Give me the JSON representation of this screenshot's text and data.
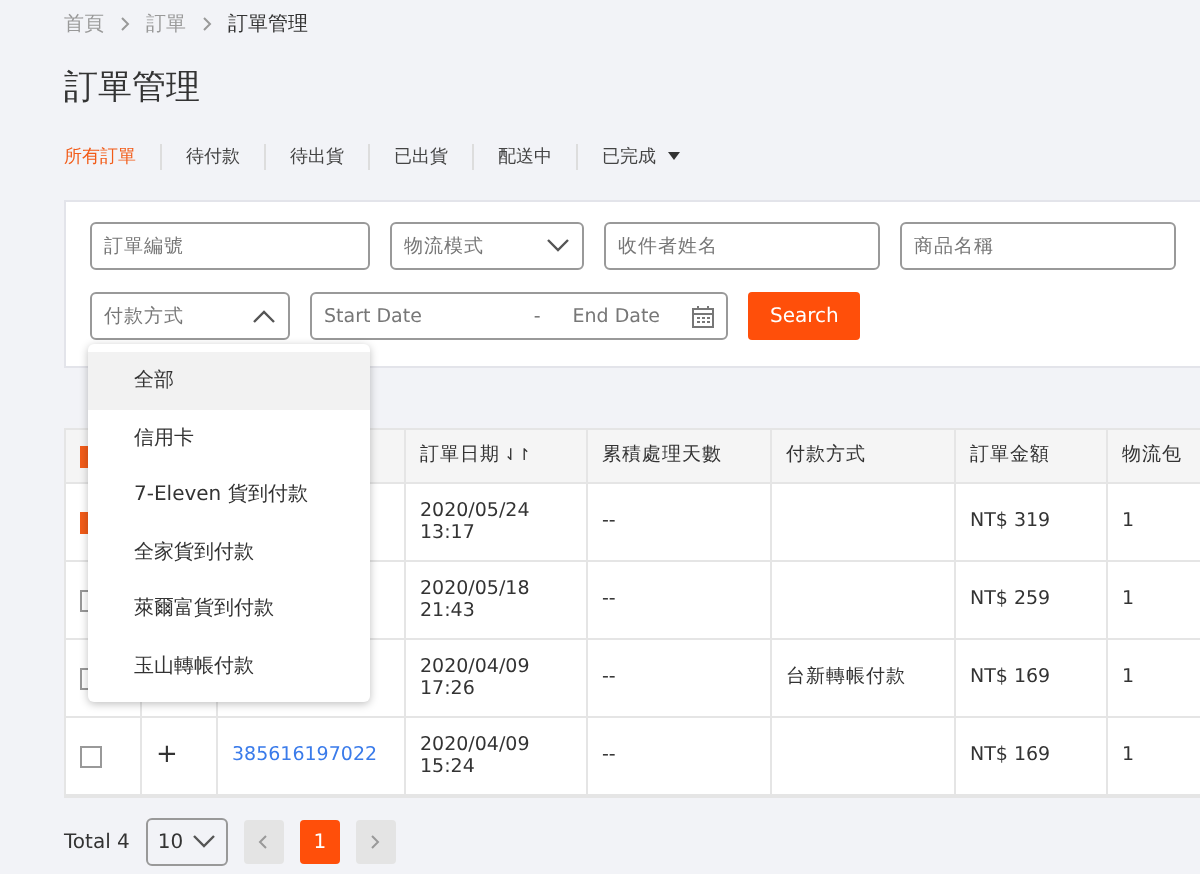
{
  "breadcrumb": [
    "首頁",
    "訂單",
    "訂單管理"
  ],
  "title": "訂單管理",
  "status_tabs": [
    {
      "label": "所有訂單",
      "selected": true,
      "kind": "plain"
    },
    {
      "label": "待付款",
      "selected": false,
      "kind": "plain"
    },
    {
      "label": "待出貨",
      "selected": false,
      "kind": "plain"
    },
    {
      "label": "已出貨",
      "selected": false,
      "kind": "plain"
    },
    {
      "label": "配送中",
      "selected": false,
      "kind": "plain"
    },
    {
      "label": "已完成",
      "selected": false,
      "kind": "menu"
    }
  ],
  "filters": {
    "order_no": {
      "placeholder": "訂單編號"
    },
    "logistics": {
      "placeholder": "物流模式",
      "expanded": false
    },
    "recipient": {
      "placeholder": "收件者姓名"
    },
    "product": {
      "placeholder": "商品名稱"
    },
    "payment": {
      "placeholder": "付款方式",
      "expanded": true
    },
    "start_date": {
      "placeholder": "Start Date"
    },
    "separator": "-",
    "end_date": {
      "placeholder": "End Date"
    },
    "search_button": "Search"
  },
  "payment_menu": [
    {
      "label": "全部",
      "selected": true
    },
    {
      "label": "信用卡",
      "selected": false
    },
    {
      "label": "7-Eleven 貨到付款",
      "selected": false
    },
    {
      "label": "全家貨到付款",
      "selected": false
    },
    {
      "label": "萊爾富貨到付款",
      "selected": false
    },
    {
      "label": "玉山轉帳付款",
      "selected": false
    }
  ],
  "table": {
    "select_all_checked": true,
    "columns": [
      "訂單日期",
      "累積處理天數",
      "付款方式",
      "訂單金額",
      "物流包"
    ],
    "sort_mark": "⇃↾",
    "rows": [
      {
        "checked": true,
        "date": "2020/05/24\n13:17",
        "days": "--",
        "payment": "",
        "amount": "NT$ 319",
        "packages": "1"
      },
      {
        "checked": false,
        "date": "2020/05/18\n21:43",
        "days": "--",
        "payment": "",
        "amount": "NT$ 259",
        "packages": "1"
      },
      {
        "checked": false,
        "date": "2020/04/09\n17:26",
        "days": "--",
        "payment": "台新轉帳付款",
        "amount": "NT$ 169",
        "packages": "1"
      },
      {
        "checked": false,
        "expand": "+",
        "order_no": "385616197022",
        "date": "2020/04/09\n15:24",
        "days": "--",
        "payment": "",
        "amount": "NT$ 169",
        "packages": "1"
      }
    ]
  },
  "pagination": {
    "total": "Total 4",
    "page_size": "10",
    "pages": [
      {
        "label": "1",
        "selected": true
      }
    ]
  }
}
